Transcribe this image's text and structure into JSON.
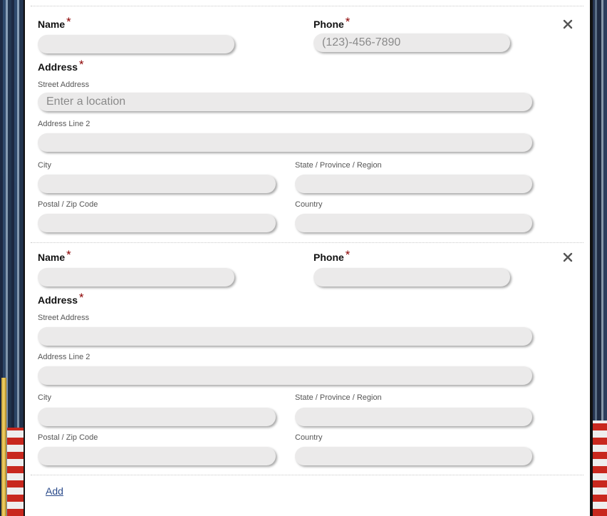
{
  "form": {
    "entries": [
      {
        "name_label": "Name",
        "phone_label": "Phone",
        "phone_placeholder": "(123)-456-7890",
        "address_label": "Address",
        "street_label": "Street Address",
        "street_placeholder": "Enter a location",
        "line2_label": "Address Line 2",
        "city_label": "City",
        "state_label": "State / Province / Region",
        "zip_label": "Postal / Zip Code",
        "country_label": "Country",
        "required_marker": "*"
      },
      {
        "name_label": "Name",
        "phone_label": "Phone",
        "phone_placeholder": "",
        "address_label": "Address",
        "street_label": "Street Address",
        "street_placeholder": "",
        "line2_label": "Address Line 2",
        "city_label": "City",
        "state_label": "State / Province / Region",
        "zip_label": "Postal / Zip Code",
        "country_label": "Country",
        "required_marker": "*"
      }
    ],
    "add_label": "Add"
  },
  "icons": {
    "remove": "close-icon"
  },
  "colors": {
    "required": "#8b0000",
    "field_bg": "#ebeaea",
    "link": "#2a4a8a"
  }
}
